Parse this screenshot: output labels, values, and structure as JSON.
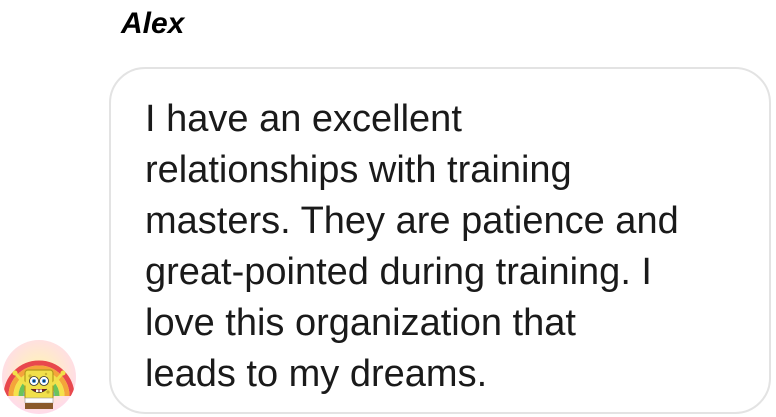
{
  "message": {
    "sender": "Alex",
    "text": "I have an excellent\nrelationships with training\nmasters. They are patience and\ngreat-pointed during training. I\nlove this organization that\nleads to my dreams."
  },
  "avatar": {
    "icon": "spongebob-imagination-avatar",
    "colors": {
      "rainbow_red": "#e8484d",
      "rainbow_orange": "#f4a53a",
      "rainbow_yellow": "#f5e14b",
      "rainbow_green": "#6cc35a",
      "rainbow_blue": "#5aa6e6",
      "rainbow_purple": "#9b6fd6",
      "sponge": "#f1e04a"
    }
  },
  "bubble": {
    "border_color": "#e3e3e3",
    "text_color": "#1a1a1a"
  }
}
